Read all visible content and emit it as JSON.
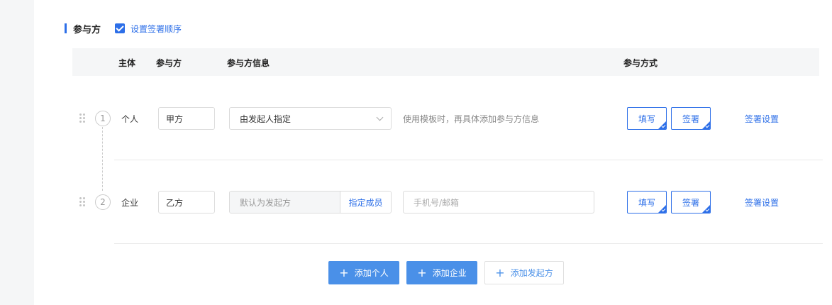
{
  "section": {
    "title": "参与方",
    "checkbox_label": "设置签署顺序",
    "checkbox_checked": true
  },
  "table": {
    "headers": {
      "subject": "主体",
      "party": "参与方",
      "party_info": "参与方信息",
      "method": "参与方式"
    }
  },
  "rows": [
    {
      "index": "1",
      "subject": "个人",
      "party_name": "甲方",
      "info_select": "由发起人指定",
      "hint": "使用模板时，再具体添加参与方信息",
      "method_fill": "填写",
      "method_sign": "签署",
      "sign_settings": "签署设置"
    },
    {
      "index": "2",
      "subject": "企业",
      "party_name": "乙方",
      "default_sender": "默认为发起方",
      "assign_member": "指定成员",
      "contact_placeholder": "手机号/邮箱",
      "method_fill": "填写",
      "method_sign": "签署",
      "sign_settings": "签署设置"
    }
  ],
  "actions": {
    "add_personal": "添加个人",
    "add_company": "添加企业",
    "add_sender": "添加发起方"
  },
  "colors": {
    "accent": "#2d6fe8",
    "primary_button": "#4a90e8"
  }
}
